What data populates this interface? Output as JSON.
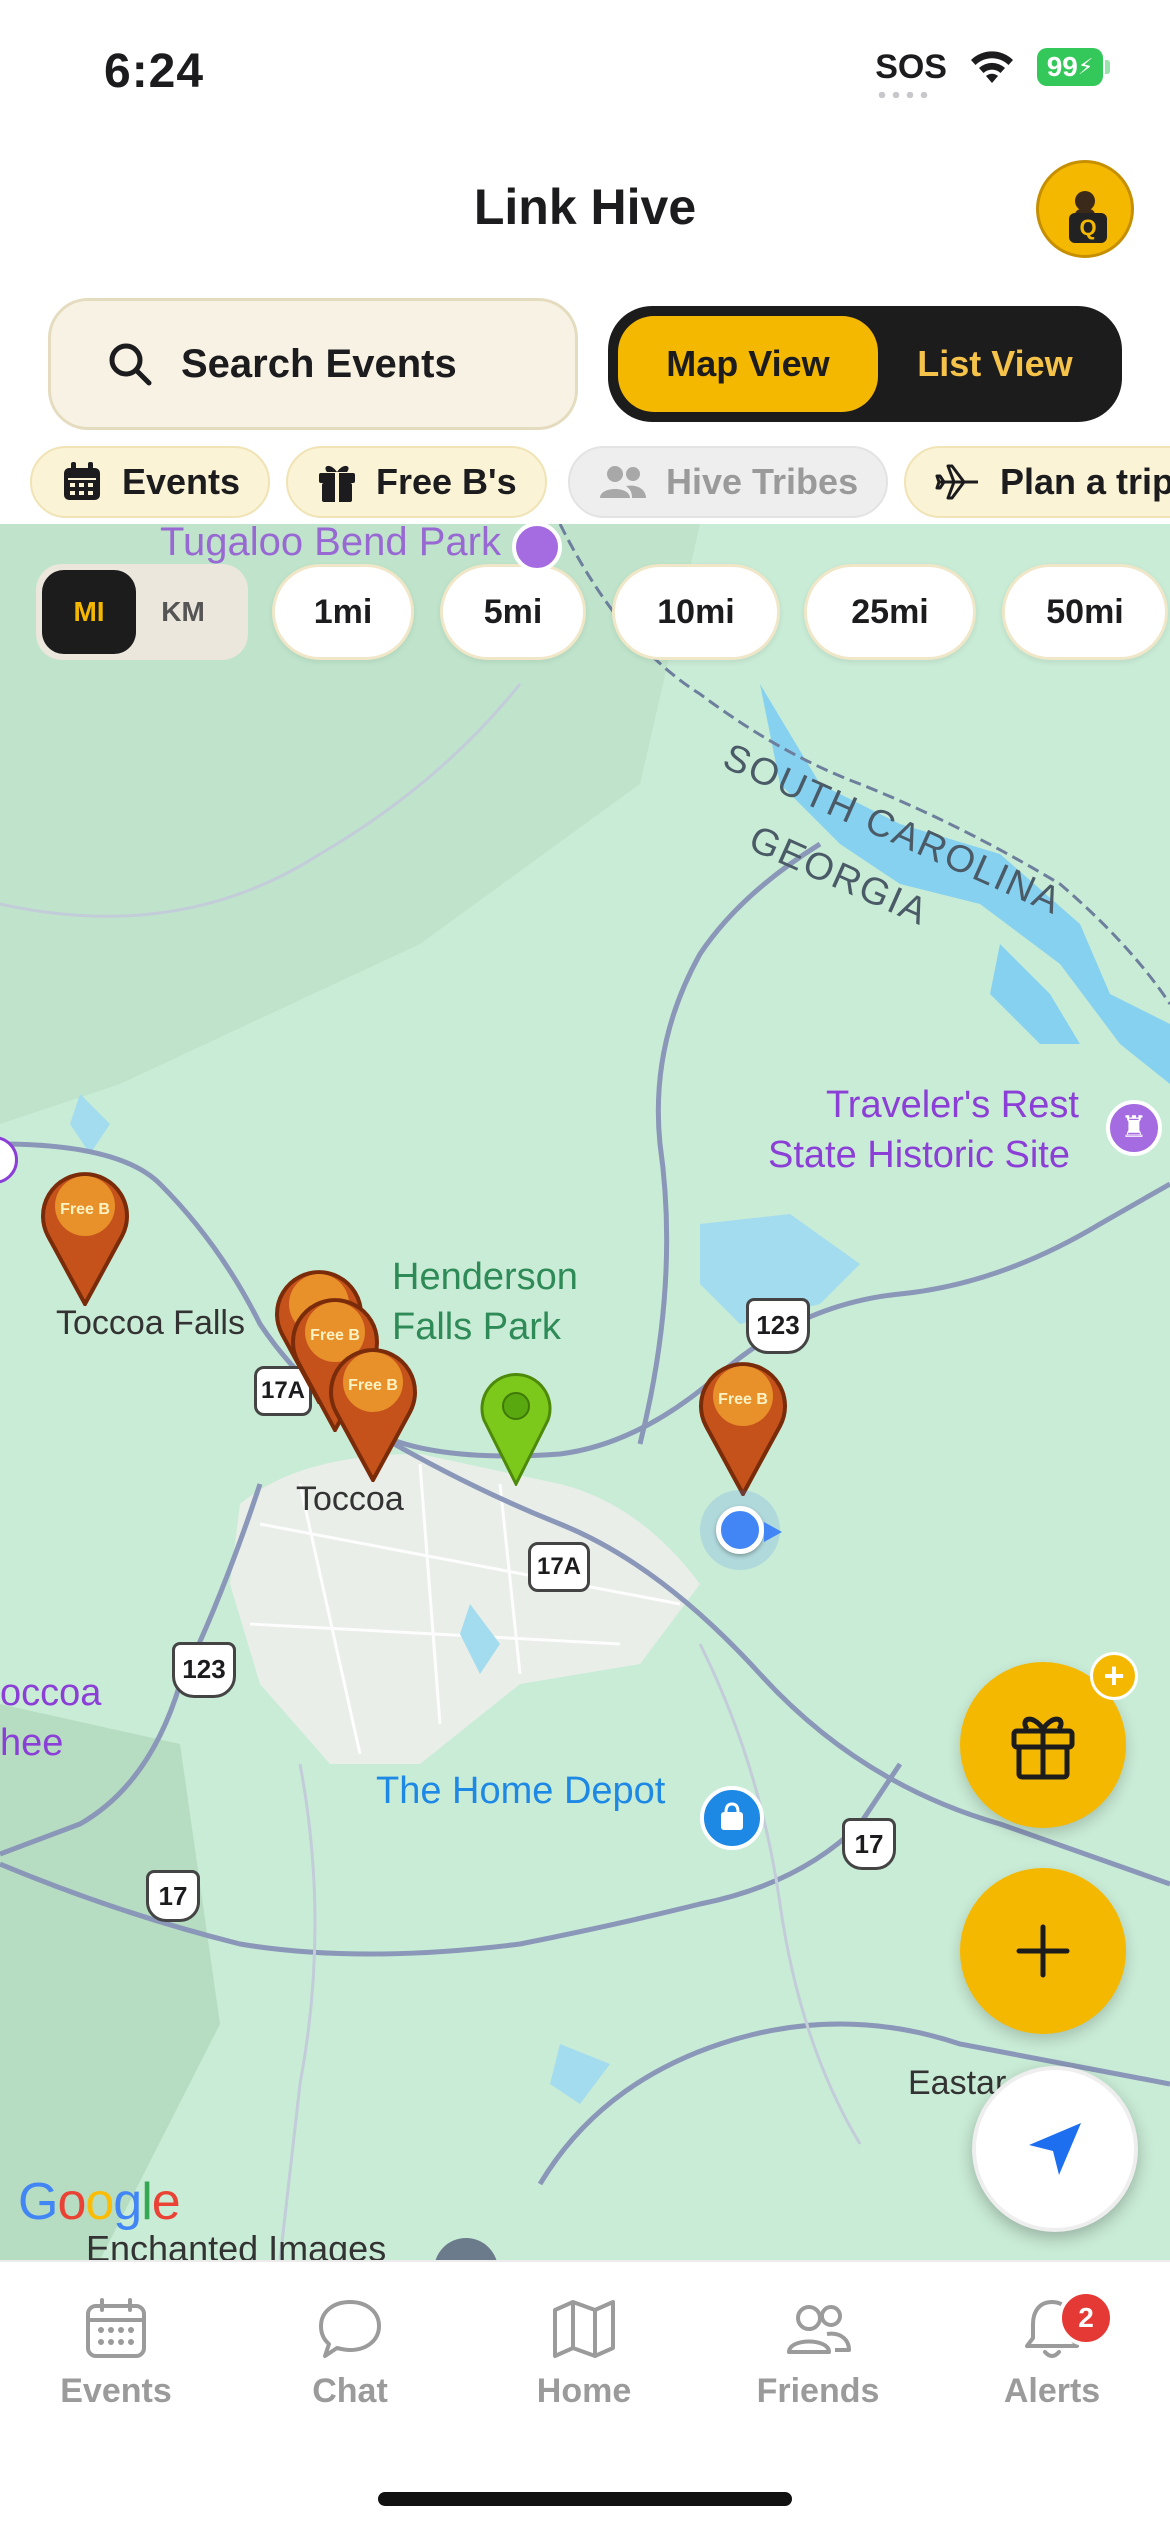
{
  "status_bar": {
    "time": "6:24",
    "sos": "SOS",
    "battery": "99"
  },
  "header": {
    "title": "Link Hive",
    "avatar_letter": "Q"
  },
  "search": {
    "placeholder": "Search Events"
  },
  "view_toggle": {
    "map": "Map View",
    "list": "List View",
    "selected": "Map View"
  },
  "categories": [
    {
      "label": "Events",
      "icon": "calendar-icon"
    },
    {
      "label": "Free B's",
      "icon": "gift-icon"
    },
    {
      "label": "Hive Tribes",
      "icon": "people-icon",
      "disabled": true
    },
    {
      "label": "Plan a trip",
      "icon": "airplane-icon"
    }
  ],
  "map": {
    "units": {
      "mi": "MI",
      "km": "KM",
      "selected": "MI"
    },
    "distances": [
      "1mi",
      "5mi",
      "10mi",
      "25mi",
      "50mi"
    ],
    "labels": {
      "tugaloo": "Tugaloo Bend Park",
      "south_carolina": "SOUTH CAROLINA",
      "georgia": "GEORGIA",
      "travelers_rest_1": "Traveler's Rest",
      "travelers_rest_2": "State Historic Site",
      "henderson_1": "Henderson",
      "henderson_2": "Falls Park",
      "toccoa_falls": "Toccoa Falls",
      "toccoa": "Toccoa",
      "home_depot": "The Home Depot",
      "toccoa_cut_1": "occoa",
      "toccoa_cut_2": "hee",
      "eastanollee": "Eastar",
      "enchanted": "Enchanted Images",
      "google": "Google"
    },
    "routes": [
      "123",
      "17A",
      "17A",
      "123",
      "17",
      "17"
    ],
    "pin_label": "Free B",
    "colors": {
      "accent": "#f5b800",
      "map_bg": "#c9ecd6",
      "water": "#87d1f0",
      "poi": "#8b3fd6"
    }
  },
  "fab": {
    "gift": "gift-icon",
    "add": "plus-icon",
    "badge": "+"
  },
  "tabs": [
    {
      "label": "Events",
      "icon": "calendar-icon"
    },
    {
      "label": "Chat",
      "icon": "chat-icon"
    },
    {
      "label": "Home",
      "icon": "map-icon"
    },
    {
      "label": "Friends",
      "icon": "friends-icon"
    },
    {
      "label": "Alerts",
      "icon": "bell-icon",
      "badge": "2"
    }
  ]
}
